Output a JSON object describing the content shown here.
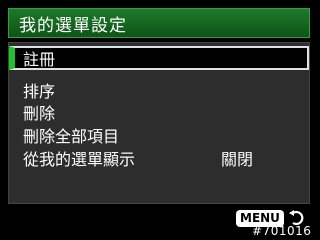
{
  "screen": {
    "title": "我的選單設定"
  },
  "menu": {
    "items": [
      {
        "label": "註冊",
        "value": ""
      },
      {
        "label": "排序",
        "value": ""
      },
      {
        "label": "刪除",
        "value": ""
      },
      {
        "label": "刪除全部項目",
        "value": ""
      },
      {
        "label": "從我的選單顯示",
        "value": "關閉"
      }
    ],
    "selected_index": 0
  },
  "footer": {
    "menu_button_label": "MENU",
    "return_icon": "return-arrow-icon",
    "watermark": "#701016"
  },
  "colors": {
    "title_bar": "#1d7a2a",
    "selection_accent": "#1fc12f",
    "panel": "#2d2d2d"
  }
}
